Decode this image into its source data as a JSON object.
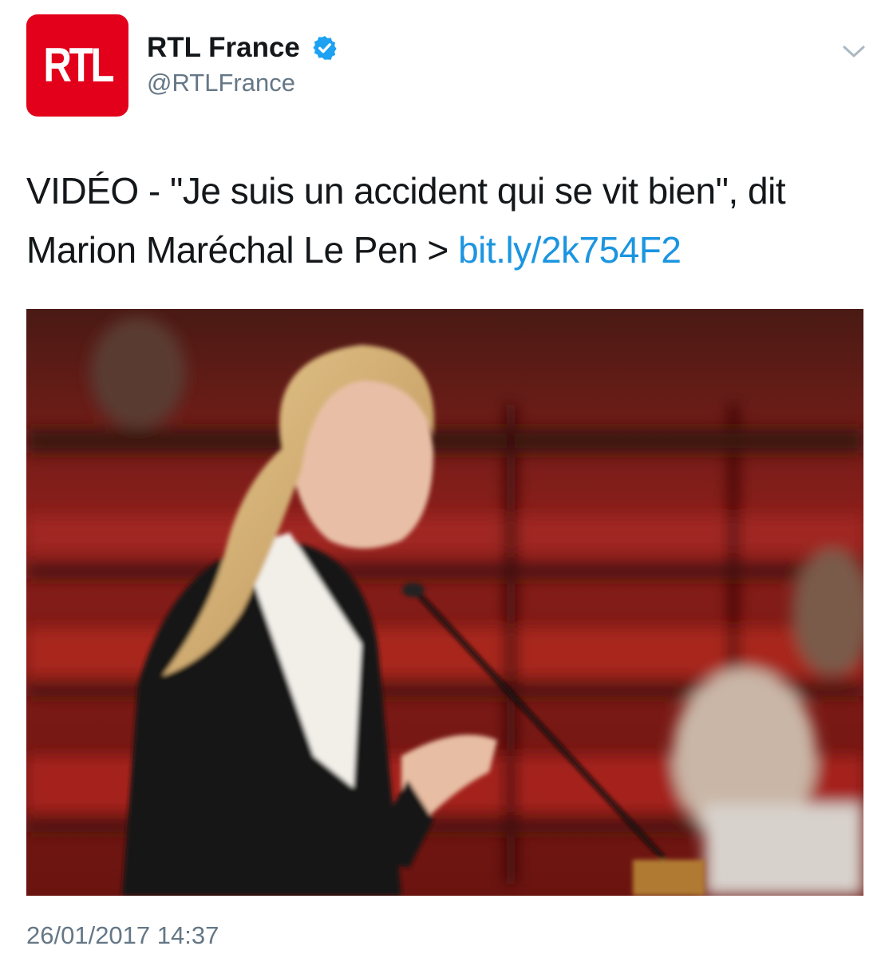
{
  "author": {
    "avatar_text": "RTL",
    "display_name": "RTL France",
    "handle": "@RTLFrance",
    "verified": true,
    "brand_color": "#e2001a",
    "verified_color": "#1da1f2"
  },
  "tweet": {
    "text": "VIDÉO - \"Je suis un accident qui se vit bien\", dit Marion Maréchal Le Pen > ",
    "link_text": "bit.ly/2k754F2",
    "link_color": "#1b95e0",
    "timestamp": "26/01/2017 14:37"
  },
  "icons": {
    "menu": "chevron-down-icon",
    "verified": "verified-badge-icon"
  }
}
